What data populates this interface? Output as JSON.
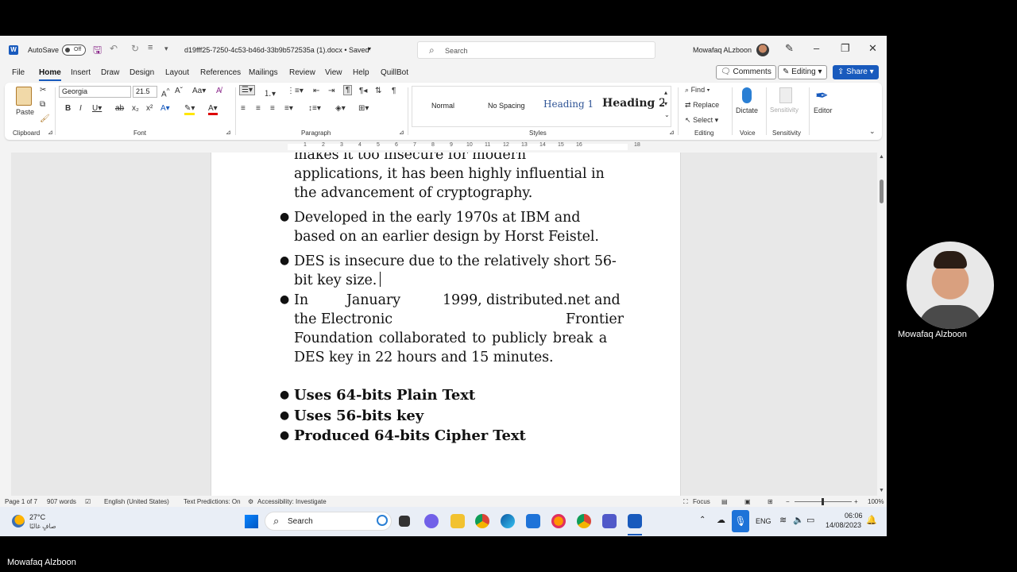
{
  "titlebar": {
    "autosave_label": "AutoSave",
    "autosave_state": "Off",
    "doc_title": "d19fff25-7250-4c53-b46d-33b9b572535a (1).docx • Saved",
    "search_placeholder": "Search",
    "user_name": "Mowafaq ALzboon"
  },
  "menu": {
    "items": [
      "File",
      "Home",
      "Insert",
      "Draw",
      "Design",
      "Layout",
      "References",
      "Mailings",
      "Review",
      "View",
      "Help",
      "QuillBot"
    ],
    "active": "Home",
    "comments_label": "Comments",
    "editing_label": "Editing",
    "share_label": "Share"
  },
  "ribbon": {
    "clipboard": {
      "paste": "Paste",
      "label": "Clipboard"
    },
    "font": {
      "name": "Georgia",
      "size": "21.5",
      "label": "Font"
    },
    "paragraph": {
      "label": "Paragraph"
    },
    "styles": {
      "items": [
        "Normal",
        "No Spacing",
        "Heading 1",
        "Heading 2"
      ],
      "label": "Styles"
    },
    "editing": {
      "find": "Find",
      "replace": "Replace",
      "select": "Select",
      "label": "Editing"
    },
    "voice": {
      "dictate": "Dictate",
      "label": "Voice"
    },
    "sensitivity": {
      "item": "Sensitivity",
      "label": "Sensitivity"
    },
    "editor": {
      "item": "Editor"
    }
  },
  "ruler": {
    "ticks": [
      "1",
      "2",
      "3",
      "4",
      "5",
      "6",
      "7",
      "8",
      "9",
      "10",
      "11",
      "12",
      "13",
      "14",
      "15",
      "16",
      "18"
    ]
  },
  "document": {
    "top_lines": [
      "makes it too insecure for modern",
      "applications, it has been highly influential in",
      "the advancement of cryptography."
    ],
    "bullets": [
      {
        "lines": [
          "Developed in the early 1970s at IBM and",
          "based on an earlier design by Horst Feistel."
        ]
      },
      {
        "lines": [
          "DES is insecure due to the relatively short 56-",
          "bit key size."
        ]
      },
      {
        "lines": [
          "Foundation collaborated to publicly break a",
          "DES key in 22 hours and 15 minutes."
        ],
        "line1": {
          "a": "In",
          "b": "January",
          "c": "1999,",
          "d": "distributed.net and"
        },
        "line2": {
          "a": "the Electronic",
          "b": "Frontier"
        }
      }
    ],
    "bold_bullets": [
      "Uses 64-bits Plain Text",
      "Uses 56-bits key",
      "Produced 64-bits Cipher Text"
    ]
  },
  "statusbar": {
    "page": "Page 1 of 7",
    "words": "907 words",
    "language": "English (United States)",
    "predictions": "Text Predictions: On",
    "accessibility": "Accessibility: Investigate",
    "focus": "Focus",
    "zoom": "100%"
  },
  "taskbar": {
    "weather_temp": "27°C",
    "weather_desc": "صافٍ غالبًا",
    "search": "Search",
    "lang": "ENG",
    "time": "06:06",
    "date": "14/08/2023"
  },
  "webcam": {
    "name": "Mowafaq Alzboon"
  },
  "footer_name": "Mowafaq Alzboon"
}
